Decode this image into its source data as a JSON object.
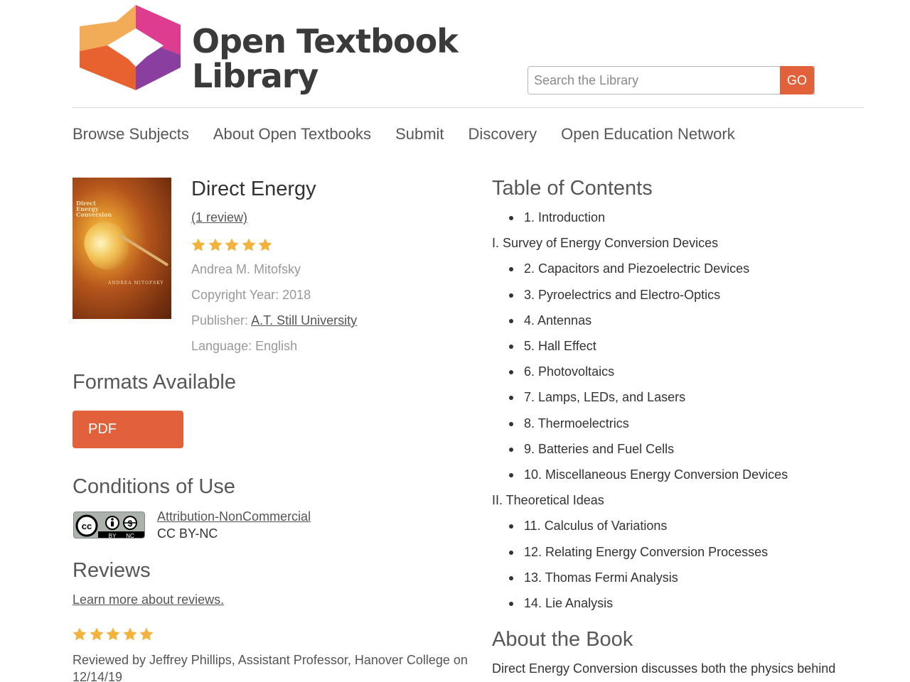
{
  "header": {
    "logo_line1": "Open Textbook",
    "logo_line2": "Library",
    "search_placeholder": "Search the Library",
    "go_label": "GO"
  },
  "nav": {
    "items": [
      "Browse Subjects",
      "About Open Textbooks",
      "Submit",
      "Discovery",
      "Open Education Network"
    ]
  },
  "book": {
    "cover_title": "Direct Energy Conversion",
    "cover_author": "ANDREA MITOFSKY",
    "title": "Direct Energy",
    "review_count": "(1 review)",
    "rating": 5,
    "author": "Andrea M. Mitofsky",
    "copyright": "Copyright Year: 2018",
    "publisher_label": "Publisher:",
    "publisher": "A.T. Still University",
    "language": "Language: English"
  },
  "formats": {
    "heading": "Formats Available",
    "pdf_label": "PDF"
  },
  "conditions": {
    "heading": "Conditions of Use",
    "license_link": "Attribution-NonCommercial",
    "license_short": "CC BY-NC",
    "badge_labels": [
      "BY",
      "NC"
    ]
  },
  "reviews": {
    "heading": "Reviews",
    "learn_more": "Learn more about reviews.",
    "rating": 5,
    "reviewer_text": "Reviewed by Jeffrey Phillips, Assistant Professor, Hanover College on 12/14/19"
  },
  "toc": {
    "heading": "Table of Contents",
    "entries": [
      {
        "text": "1. Introduction",
        "bullet": true
      },
      {
        "text": "I. Survey of Energy Conversion Devices",
        "bullet": false
      },
      {
        "text": "2. Capacitors and Piezoelectric Devices",
        "bullet": true
      },
      {
        "text": "3. Pyroelectrics and Electro-Optics",
        "bullet": true
      },
      {
        "text": "4. Antennas",
        "bullet": true
      },
      {
        "text": "5. Hall Effect",
        "bullet": true
      },
      {
        "text": "6. Photovoltaics",
        "bullet": true
      },
      {
        "text": "7. Lamps, LEDs, and Lasers",
        "bullet": true
      },
      {
        "text": "8. Thermoelectrics",
        "bullet": true
      },
      {
        "text": "9. Batteries and Fuel Cells",
        "bullet": true
      },
      {
        "text": "10. Miscellaneous Energy Conversion Devices",
        "bullet": true
      },
      {
        "text": "II. Theoretical Ideas",
        "bullet": false
      },
      {
        "text": "11. Calculus of Variations",
        "bullet": true
      },
      {
        "text": "12. Relating Energy Conversion Processes",
        "bullet": true
      },
      {
        "text": "13. Thomas Fermi Analysis",
        "bullet": true
      },
      {
        "text": "14. Lie Analysis",
        "bullet": true
      }
    ]
  },
  "about": {
    "heading": "About the Book",
    "text": "Direct Energy Conversion discusses both the physics behind"
  },
  "colors": {
    "accent": "#e0613a",
    "star": "#f2b33d",
    "heading": "#575757",
    "muted": "#999999"
  }
}
